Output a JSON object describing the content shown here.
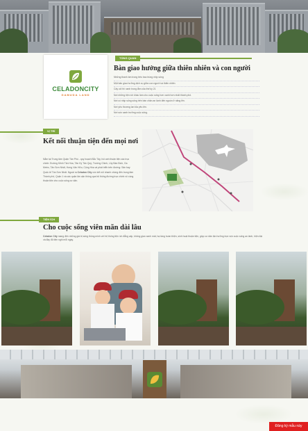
{
  "section1": {
    "tag": "TỔNG QUAN",
    "title": "Bàn giao hưởng giữa thiên nhiên và con người",
    "logo_brand": "CELADONCITY",
    "logo_sub": "GAMUDA LAND",
    "bullets": [
      "Những thanh âm trong trẻo bao trùng nhịp sống",
      "Một bản giao hưởng dịch vụ giữa con người và thiên nhiên",
      "Cây cối thì xanh trong lắm của thế kỷ 21",
      "Nơi những tiện ích khác làm cho cuộc sống hơn xanh hơn nhất thành phố.",
      "Nơi có nhịp sống sống trên bàn chân an lành đến nguồn ở năng lên.",
      "Nơi yêu thương lan tỏa yêu lên.",
      "Nơi sức sanh trưởng cuộc sống."
    ]
  },
  "section2": {
    "tag": "VỊ TRÍ",
    "title": "Kết nối thuận tiện đến mọi nơi",
    "paragraph_lead": "Nằm tại Trung tâm Quận Tân Phú - quy hoạch Bắc Tây, hồi anh thuận tiện các trục chính: Đường Kênh Tân Hóa, Tân Kỳ Tân Quý, Trường Chinh, Lũy Bán Bích, Ga Metro, Tân Sơn Nhất, Hưng Vân Hữu, Cộng Hòa và phát triển trên đường: Sân bay Quốc tế Tân Sơn Nhất. Ngoài ra",
    "paragraph_brand": "Celadon City",
    "paragraph_tail": "còn kết nối nhanh chóng đến trung tâm Thành phố, Quận 1 và các quận lân cận thông qua hệ thống đường trục chính vô cùng thuận tiện cho cuộc sống cư dân."
  },
  "section3": {
    "tag": "TIỆN ÍCH",
    "title": "Cho cuộc sống viên mãn dài lâu",
    "paragraph_brand": "Celadon City",
    "paragraph": "mang đến những giá trị sống thông minh với hệ thống tiện ích đẳng cấp, không gian xanh mát, hạ tầng hoàn thiện, sinh hoạt thuận tiện, giúp cư dân tận hưởng trọn vẹn cuộc sống an lành, hiện đại và đầy đủ tiện nghi mỗi ngày."
  },
  "cta": {
    "label": "Đăng ký mẫu này"
  },
  "colors": {
    "accent": "#7fa83e",
    "cta": "#e02020",
    "road": "#c0457a"
  }
}
